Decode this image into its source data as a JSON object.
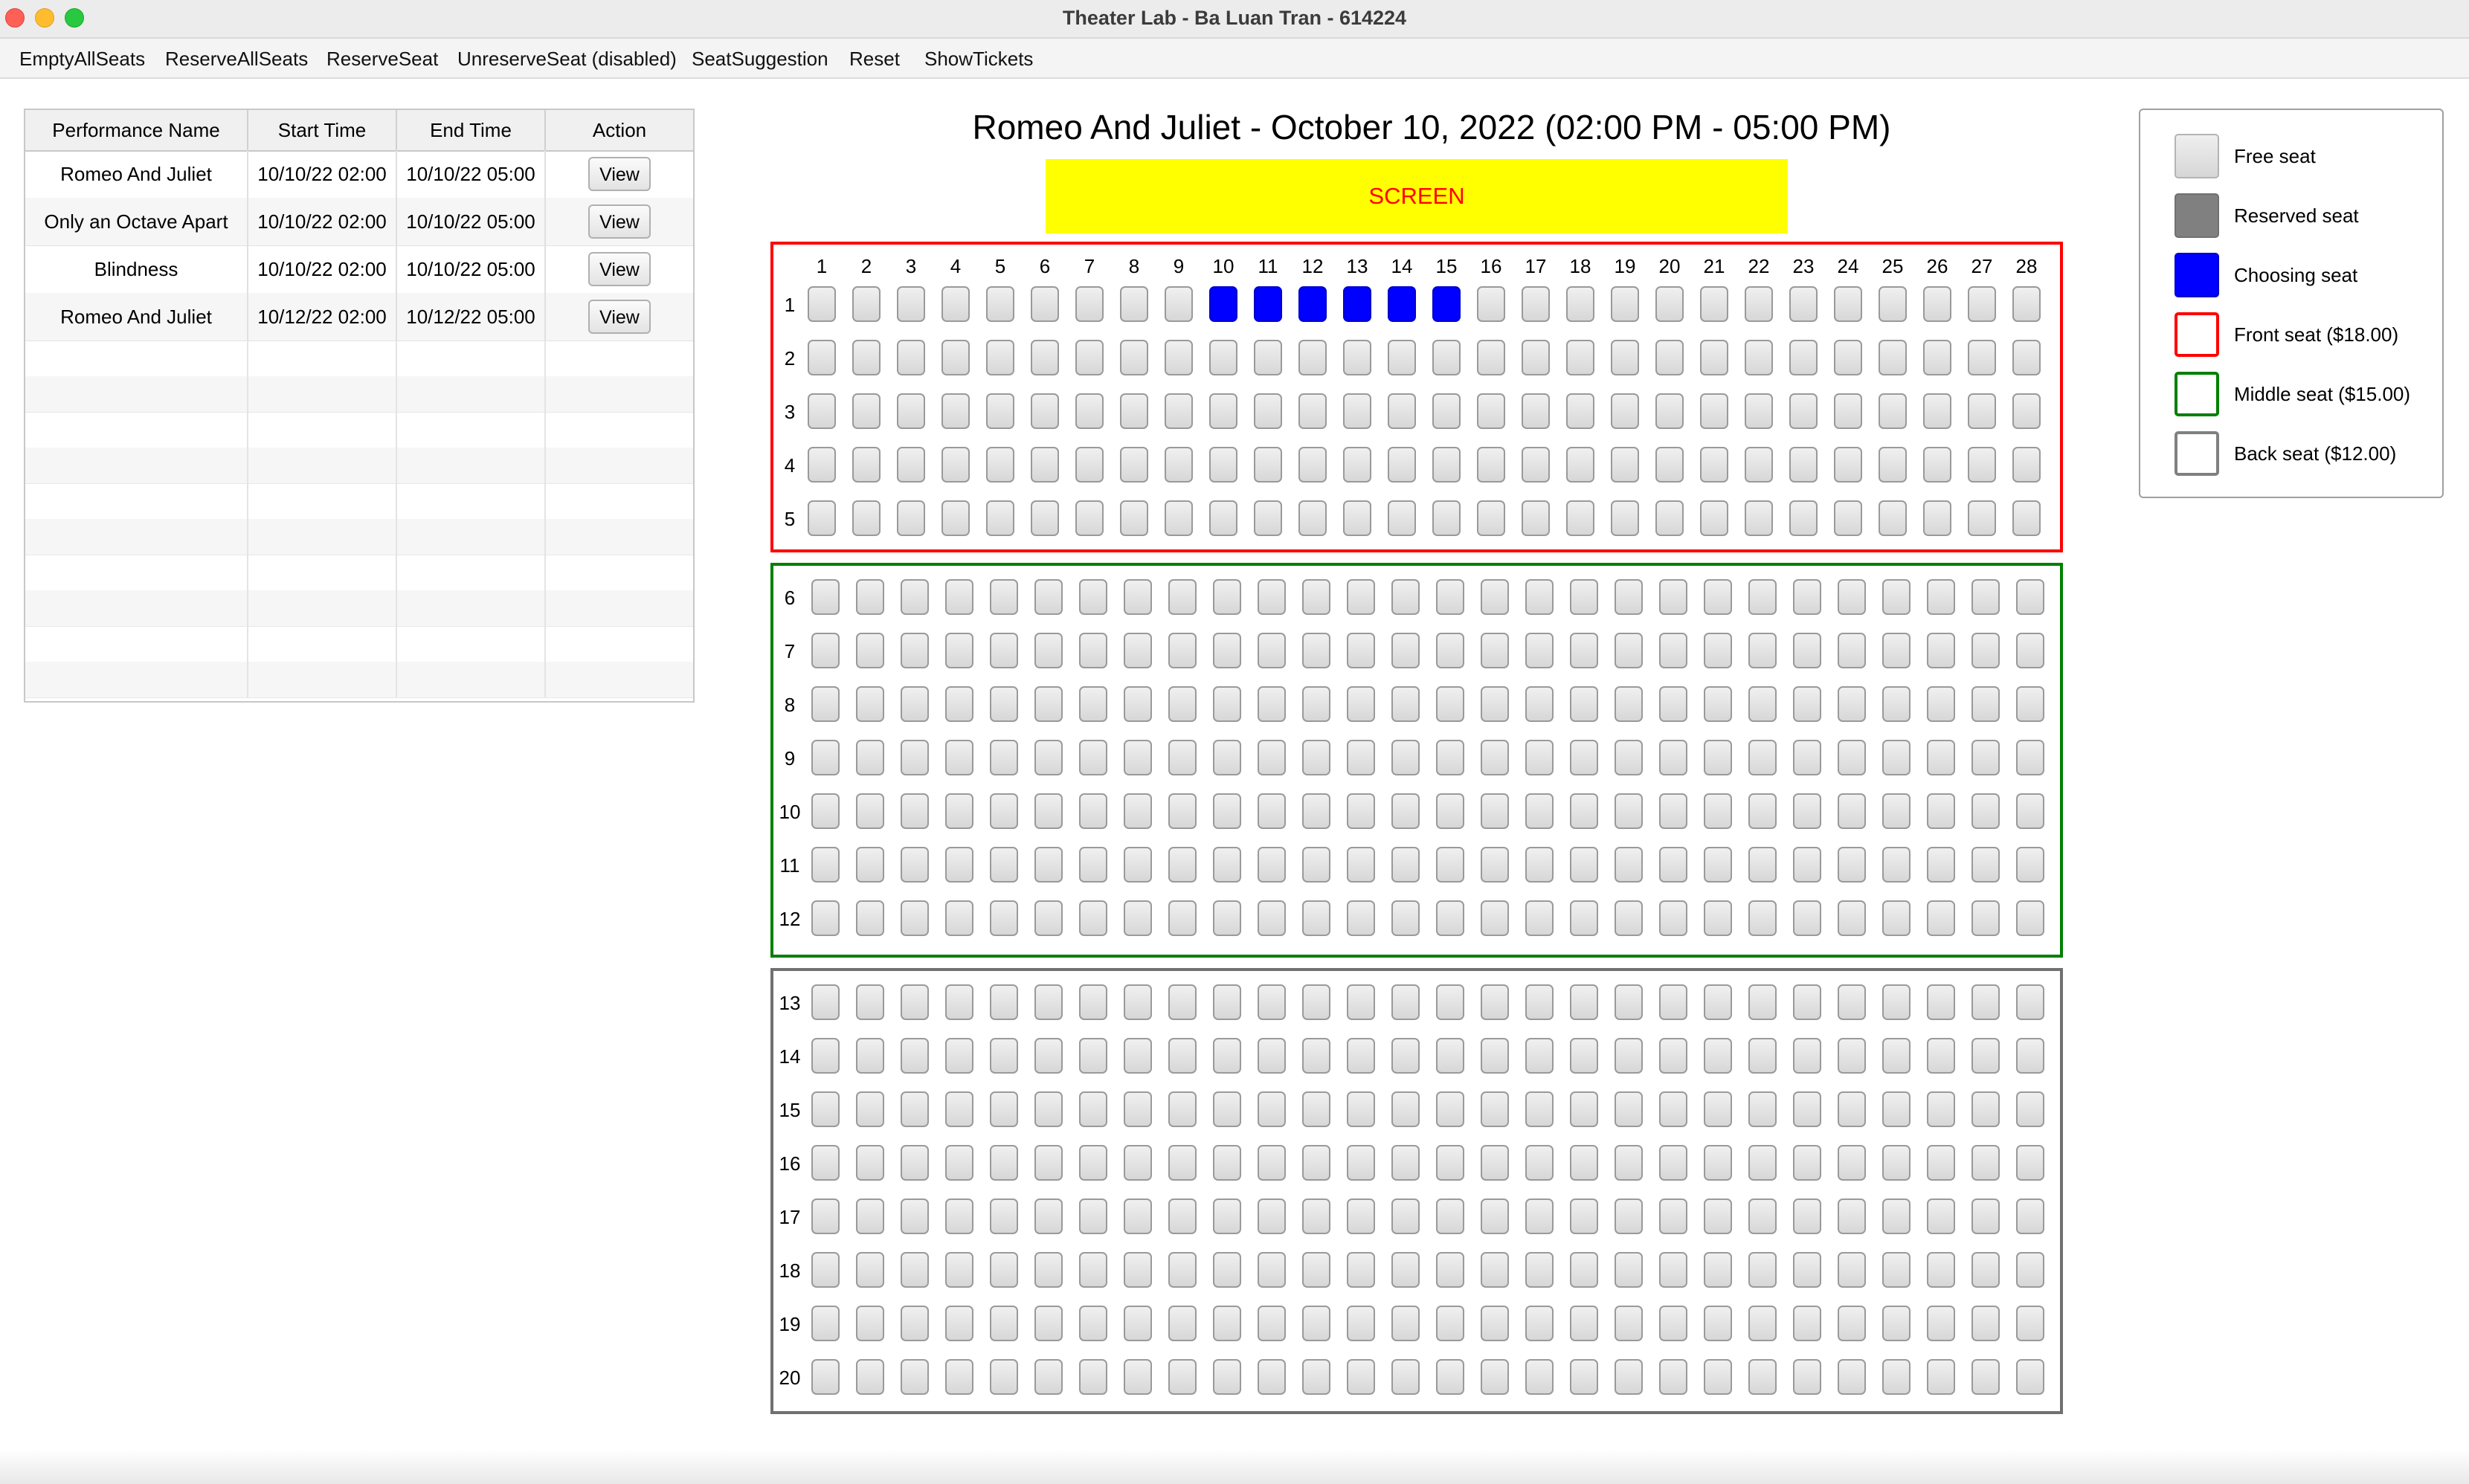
{
  "window": {
    "title": "Theater Lab - Ba Luan Tran - 614224"
  },
  "menu": [
    {
      "label": "EmptyAllSeats"
    },
    {
      "label": "ReserveAllSeats"
    },
    {
      "label": "ReserveSeat"
    },
    {
      "label": "UnreserveSeat (disabled)"
    },
    {
      "label": "SeatSuggestion"
    },
    {
      "label": "Reset"
    },
    {
      "label": "ShowTickets"
    }
  ],
  "performances": {
    "columns": [
      "Performance Name",
      "Start Time",
      "End Time",
      "Action"
    ],
    "rows": [
      {
        "name": "Romeo And Juliet",
        "start": "10/10/22 02:00",
        "end": "10/10/22 05:00",
        "action": "View"
      },
      {
        "name": "Only an Octave Apart",
        "start": "10/10/22 02:00",
        "end": "10/10/22 05:00",
        "action": "View"
      },
      {
        "name": "Blindness",
        "start": "10/10/22 02:00",
        "end": "10/10/22 05:00",
        "action": "View"
      },
      {
        "name": "Romeo And Juliet",
        "start": "10/12/22 02:00",
        "end": "10/12/22 05:00",
        "action": "View"
      }
    ]
  },
  "show": {
    "title": "Romeo And Juliet - October 10, 2022 (02:00 PM - 05:00 PM)",
    "screen_label": "SCREEN"
  },
  "seating": {
    "columns": 28,
    "sections": [
      {
        "name": "front",
        "color": "#ff0000",
        "rows": [
          1,
          2,
          3,
          4,
          5
        ]
      },
      {
        "name": "middle",
        "color": "#008000",
        "rows": [
          6,
          7,
          8,
          9,
          10,
          11,
          12
        ]
      },
      {
        "name": "back",
        "color": "#808080",
        "rows": [
          13,
          14,
          15,
          16,
          17,
          18,
          19,
          20
        ]
      }
    ],
    "choosing": [
      {
        "row": 1,
        "cols": [
          10,
          11,
          12,
          13,
          14,
          15
        ]
      }
    ],
    "reserved": []
  },
  "legend": [
    {
      "kind": "free",
      "label": "Free seat"
    },
    {
      "kind": "reserved",
      "label": "Reserved seat"
    },
    {
      "kind": "choosing",
      "label": "Choosing seat"
    },
    {
      "kind": "front",
      "label": "Front seat ($18.00)"
    },
    {
      "kind": "middle",
      "label": "Middle seat ($15.00)"
    },
    {
      "kind": "back",
      "label": "Back seat ($12.00)"
    }
  ]
}
